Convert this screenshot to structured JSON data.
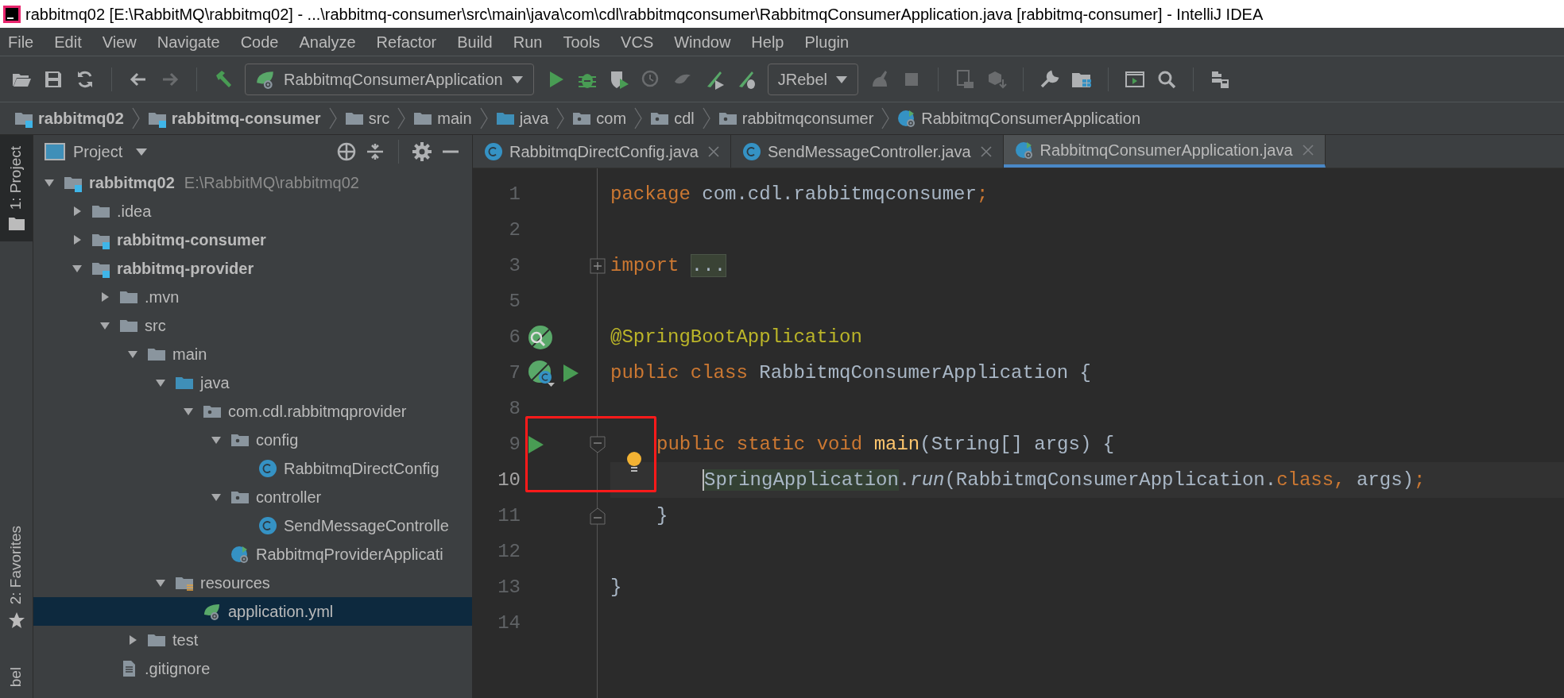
{
  "window": {
    "title": "rabbitmq02 [E:\\RabbitMQ\\rabbitmq02] - ...\\rabbitmq-consumer\\src\\main\\java\\com\\cdl\\rabbitmqconsumer\\RabbitmqConsumerApplication.java [rabbitmq-consumer] - IntelliJ IDEA"
  },
  "menu": [
    "File",
    "Edit",
    "View",
    "Navigate",
    "Code",
    "Analyze",
    "Refactor",
    "Build",
    "Run",
    "Tools",
    "VCS",
    "Window",
    "Help",
    "Plugin"
  ],
  "toolbar": {
    "run_configuration": "RabbitmqConsumerApplication",
    "jrebel": "JRebel"
  },
  "breadcrumbs": [
    {
      "label": "rabbitmq02",
      "kind": "module"
    },
    {
      "label": "rabbitmq-consumer",
      "kind": "module"
    },
    {
      "label": "src",
      "kind": "folder"
    },
    {
      "label": "main",
      "kind": "folder"
    },
    {
      "label": "java",
      "kind": "source"
    },
    {
      "label": "com",
      "kind": "package"
    },
    {
      "label": "cdl",
      "kind": "package"
    },
    {
      "label": "rabbitmqconsumer",
      "kind": "package"
    },
    {
      "label": "RabbitmqConsumerApplication",
      "kind": "spring-class"
    }
  ],
  "tool_strip": [
    {
      "label": "1: Project",
      "selected": true,
      "kind": "project"
    },
    {
      "label": "2: Favorites",
      "selected": false,
      "kind": "favorites"
    },
    {
      "label": "bel",
      "selected": false,
      "kind": "plain"
    }
  ],
  "project_panel": {
    "title": "Project",
    "tree": [
      {
        "label": "rabbitmq02",
        "hint": "E:\\RabbitMQ\\rabbitmq02",
        "kind": "module",
        "expanded": true,
        "selected": false,
        "children": [
          {
            "label": ".idea",
            "kind": "folder",
            "expanded": false,
            "selected": false
          },
          {
            "label": "rabbitmq-consumer",
            "kind": "module",
            "expanded": false,
            "selected": false
          },
          {
            "label": "rabbitmq-provider",
            "kind": "module",
            "expanded": true,
            "selected": false,
            "children": [
              {
                "label": ".mvn",
                "kind": "folder",
                "expanded": false,
                "selected": false
              },
              {
                "label": "src",
                "kind": "folder",
                "expanded": true,
                "selected": false,
                "children": [
                  {
                    "label": "main",
                    "kind": "folder",
                    "expanded": true,
                    "selected": false,
                    "children": [
                      {
                        "label": "java",
                        "kind": "source",
                        "expanded": true,
                        "selected": false,
                        "children": [
                          {
                            "label": "com.cdl.rabbitmqprovider",
                            "kind": "package",
                            "expanded": true,
                            "selected": false,
                            "children": [
                              {
                                "label": "config",
                                "kind": "package",
                                "expanded": true,
                                "selected": false,
                                "children": [
                                  {
                                    "label": "RabbitmqDirectConfig",
                                    "kind": "class",
                                    "selected": false
                                  }
                                ]
                              },
                              {
                                "label": "controller",
                                "kind": "package",
                                "expanded": true,
                                "selected": false,
                                "children": [
                                  {
                                    "label": "SendMessageControlle",
                                    "kind": "class",
                                    "selected": false
                                  }
                                ]
                              },
                              {
                                "label": "RabbitmqProviderApplicati",
                                "kind": "spring-class",
                                "selected": false
                              }
                            ]
                          }
                        ]
                      },
                      {
                        "label": "resources",
                        "kind": "resources",
                        "expanded": true,
                        "selected": false,
                        "children": [
                          {
                            "label": "application.yml",
                            "kind": "yml",
                            "selected": true
                          }
                        ]
                      }
                    ]
                  },
                  {
                    "label": "test",
                    "kind": "folder",
                    "expanded": false,
                    "selected": false
                  }
                ]
              },
              {
                "label": ".gitignore",
                "kind": "file",
                "selected": false
              }
            ]
          }
        ]
      }
    ]
  },
  "editor_tabs": [
    {
      "label": "RabbitmqDirectConfig.java",
      "kind": "class",
      "selected": false
    },
    {
      "label": "SendMessageController.java",
      "kind": "class",
      "selected": false
    },
    {
      "label": "RabbitmqConsumerApplication.java",
      "kind": "spring-class",
      "selected": true
    }
  ],
  "code": [
    {
      "number": "1",
      "current": false,
      "tokens": [
        {
          "kind": "keyword",
          "text": "package"
        },
        {
          "kind": "plain",
          "text": " com.cdl.rabbitmqconsumer"
        },
        {
          "kind": "keyword",
          "text": ";"
        }
      ]
    },
    {
      "number": "2",
      "current": false
    },
    {
      "number": "3",
      "current": false,
      "fold": {
        "kind": "expand"
      },
      "tokens": [
        {
          "kind": "keyword",
          "text": "import "
        },
        {
          "kind": "folded",
          "text": "..."
        }
      ]
    },
    {
      "number": "5",
      "current": false
    },
    {
      "number": "6",
      "current": false,
      "gutter": [
        {
          "kind": "spring-search"
        }
      ],
      "tokens": [
        {
          "kind": "annotation",
          "text": "@SpringBootApplication"
        }
      ]
    },
    {
      "number": "7",
      "current": false,
      "gutter": [
        {
          "kind": "spring-class"
        },
        {
          "kind": "run"
        }
      ],
      "tokens": [
        {
          "kind": "keyword",
          "text": "public class"
        },
        {
          "kind": "plain",
          "text": " RabbitmqConsumerApplication {"
        }
      ],
      "children": [
        {
          "number": "8",
          "current": false
        },
        {
          "number": "9",
          "current": false,
          "gutter": [
            {
              "kind": "run"
            }
          ],
          "fold": {
            "kind": "start"
          },
          "tokens": [
            {
              "kind": "keyword",
              "text": "public static void "
            },
            {
              "kind": "method",
              "text": "main"
            },
            {
              "kind": "plain",
              "text": "(String[] args) {"
            }
          ],
          "children": [
            {
              "number": "10",
              "current": true,
              "bulb": true,
              "tokens": [
                {
                  "kind": "marked",
                  "text": "SpringApplication"
                },
                {
                  "kind": "plain",
                  "text": "."
                },
                {
                  "kind": "static",
                  "text": "run"
                },
                {
                  "kind": "plain",
                  "text": "(RabbitmqConsumerApplication."
                },
                {
                  "kind": "keyword",
                  "text": "class"
                },
                {
                  "kind": "keyword",
                  "text": ", "
                },
                {
                  "kind": "plain",
                  "text": "args)"
                },
                {
                  "kind": "keyword",
                  "text": ";"
                }
              ]
            }
          ]
        },
        {
          "number": "11",
          "current": false,
          "fold": {
            "kind": "end"
          },
          "tokens": [
            {
              "kind": "plain",
              "text": "}"
            }
          ]
        },
        {
          "number": "12",
          "current": false
        }
      ]
    },
    {
      "number": "13",
      "current": false,
      "tokens": [
        {
          "kind": "plain",
          "text": "}"
        }
      ]
    },
    {
      "number": "14",
      "current": false
    }
  ]
}
